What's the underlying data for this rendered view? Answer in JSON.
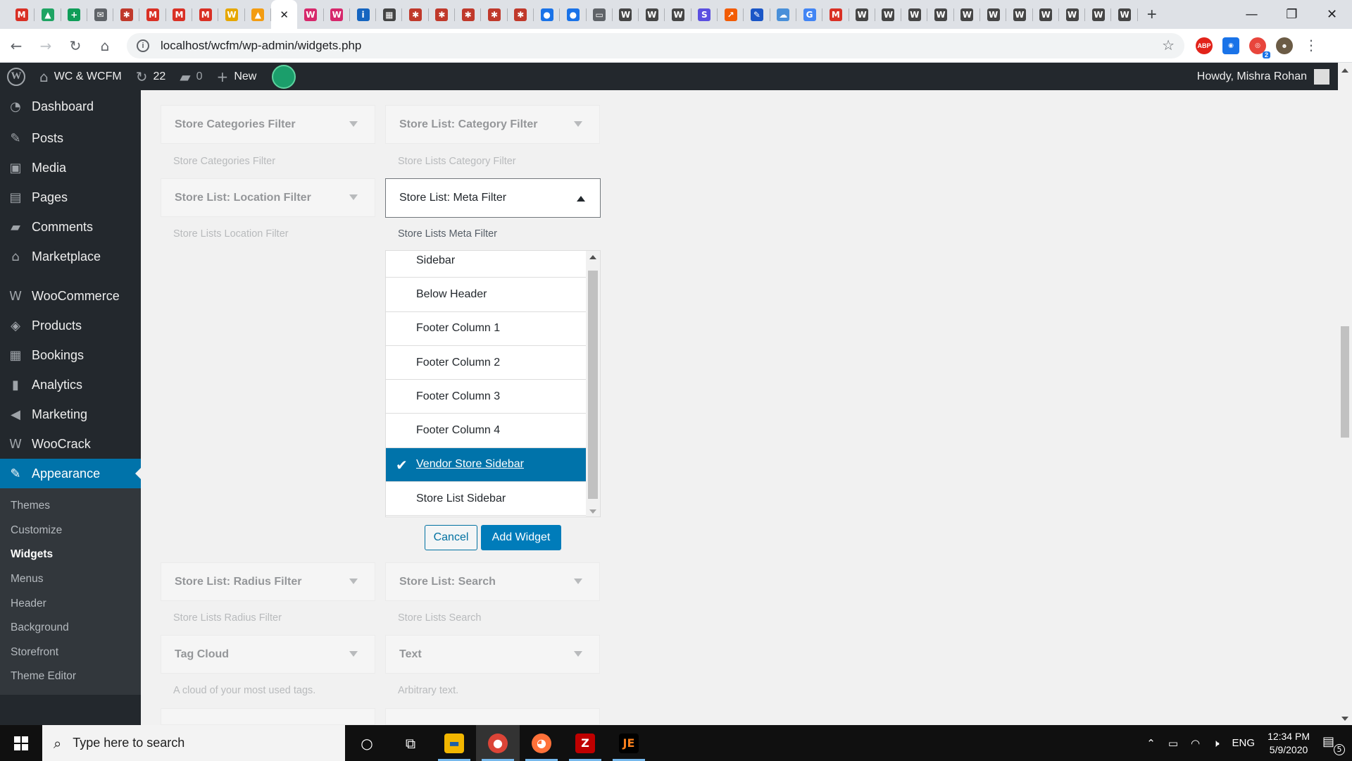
{
  "browser": {
    "tab_favicons": [
      {
        "icon": "gmail-icon",
        "glyph": "M",
        "color": "#d93025"
      },
      {
        "icon": "google-drive-icon",
        "glyph": "▲",
        "color": "#1fa463"
      },
      {
        "icon": "google-sheets-icon",
        "glyph": "+",
        "color": "#0f9d58"
      },
      {
        "icon": "mail-icon",
        "glyph": "✉",
        "color": "#5f6368"
      },
      {
        "icon": "site-icon",
        "glyph": "✱",
        "color": "#c0392b"
      },
      {
        "icon": "gmail-icon",
        "glyph": "M",
        "color": "#d93025"
      },
      {
        "icon": "gmail-icon",
        "glyph": "M",
        "color": "#d93025"
      },
      {
        "icon": "gmail-icon",
        "glyph": "M",
        "color": "#d93025"
      },
      {
        "icon": "site-icon",
        "glyph": "W",
        "color": "#e6a700"
      },
      {
        "icon": "phpmyadmin-icon",
        "glyph": "▲",
        "color": "#f39c12"
      },
      {
        "icon": "site-icon",
        "glyph": "✱",
        "color": "#c0392b"
      },
      {
        "icon": "woocommerce-icon",
        "glyph": "W",
        "color": "#d6286b"
      },
      {
        "icon": "woocommerce-icon",
        "glyph": "W",
        "color": "#d6286b"
      },
      {
        "icon": "ibb-icon",
        "glyph": "i",
        "color": "#1565c0"
      },
      {
        "icon": "film-icon",
        "glyph": "▦",
        "color": "#444"
      },
      {
        "icon": "site-icon",
        "glyph": "✱",
        "color": "#c0392b"
      },
      {
        "icon": "site-icon",
        "glyph": "✱",
        "color": "#c0392b"
      },
      {
        "icon": "site-icon",
        "glyph": "✱",
        "color": "#c0392b"
      },
      {
        "icon": "site-icon",
        "glyph": "✱",
        "color": "#c0392b"
      },
      {
        "icon": "site-icon",
        "glyph": "✱",
        "color": "#c0392b"
      },
      {
        "icon": "globe-icon",
        "glyph": "●",
        "color": "#1a73e8"
      },
      {
        "icon": "globe-icon",
        "glyph": "●",
        "color": "#1a73e8"
      },
      {
        "icon": "monitor-icon",
        "glyph": "▭",
        "color": "#5f6368"
      },
      {
        "icon": "wordpress-icon",
        "glyph": "W",
        "color": "#464646"
      },
      {
        "icon": "wordpress-icon",
        "glyph": "W",
        "color": "#464646"
      },
      {
        "icon": "wordpress-icon",
        "glyph": "W",
        "color": "#464646"
      },
      {
        "icon": "s-icon",
        "glyph": "S",
        "color": "#5b4fe0"
      },
      {
        "icon": "arrow-icon",
        "glyph": "↗",
        "color": "#f25c05"
      },
      {
        "icon": "feather-icon",
        "glyph": "✎",
        "color": "#1a56c7"
      },
      {
        "icon": "cloud-icon",
        "glyph": "☁",
        "color": "#4a90d9"
      },
      {
        "icon": "google-icon",
        "glyph": "G",
        "color": "#4285f4"
      },
      {
        "icon": "gmail-icon",
        "glyph": "M",
        "color": "#d93025"
      },
      {
        "icon": "wordpress-icon",
        "glyph": "W",
        "color": "#464646"
      },
      {
        "icon": "wordpress-icon",
        "glyph": "W",
        "color": "#464646"
      },
      {
        "icon": "wordpress-icon",
        "glyph": "W",
        "color": "#464646"
      },
      {
        "icon": "wordpress-icon",
        "glyph": "W",
        "color": "#464646"
      },
      {
        "icon": "wordpress-icon",
        "glyph": "W",
        "color": "#464646"
      },
      {
        "icon": "wordpress-icon",
        "glyph": "W",
        "color": "#464646"
      },
      {
        "icon": "wordpress-icon",
        "glyph": "W",
        "color": "#464646"
      },
      {
        "icon": "wordpress-icon",
        "glyph": "W",
        "color": "#464646"
      },
      {
        "icon": "wordpress-icon",
        "glyph": "W",
        "color": "#464646"
      },
      {
        "icon": "wordpress-icon",
        "glyph": "W",
        "color": "#464646"
      },
      {
        "icon": "wordpress-icon",
        "glyph": "W",
        "color": "#464646"
      }
    ],
    "active_tab_index": 10,
    "url": "localhost/wcfm/wp-admin/widgets.php",
    "extension_badge": "2"
  },
  "adminbar": {
    "site_name": "WC & WCFM",
    "updates_count": "22",
    "comments_count": "0",
    "new_label": "New",
    "greeting": "Howdy, Mishra Rohan"
  },
  "sidebar": {
    "items": [
      {
        "label": "Dashboard",
        "icon": "dashboard-icon",
        "glyph": "◔"
      },
      {
        "label": "Posts",
        "icon": "pin-icon",
        "glyph": "✎"
      },
      {
        "label": "Media",
        "icon": "media-icon",
        "glyph": "▣"
      },
      {
        "label": "Pages",
        "icon": "pages-icon",
        "glyph": "▤"
      },
      {
        "label": "Comments",
        "icon": "comment-icon",
        "glyph": "▰"
      },
      {
        "label": "Marketplace",
        "icon": "marketplace-icon",
        "glyph": "⌂"
      },
      {
        "label": "WooCommerce",
        "icon": "woocommerce-icon",
        "glyph": "W"
      },
      {
        "label": "Products",
        "icon": "box-icon",
        "glyph": "◈"
      },
      {
        "label": "Bookings",
        "icon": "calendar-icon",
        "glyph": "▦"
      },
      {
        "label": "Analytics",
        "icon": "bar-chart-icon",
        "glyph": "▮"
      },
      {
        "label": "Marketing",
        "icon": "megaphone-icon",
        "glyph": "◀"
      },
      {
        "label": "WooCrack",
        "icon": "woocrack-icon",
        "glyph": "W"
      },
      {
        "label": "Appearance",
        "icon": "brush-icon",
        "glyph": "✎"
      }
    ],
    "submenu": [
      "Themes",
      "Customize",
      "Widgets",
      "Menus",
      "Header",
      "Background",
      "Storefront",
      "Theme Editor"
    ]
  },
  "widgets": {
    "store_categories_filter": {
      "title": "Store Categories Filter",
      "desc": "Store Categories Filter"
    },
    "store_list_category_filter": {
      "title": "Store List: Category Filter",
      "desc": "Store Lists Category Filter"
    },
    "store_list_location_filter": {
      "title": "Store List: Location Filter",
      "desc": "Store Lists Location Filter"
    },
    "store_list_meta_filter": {
      "title": "Store List: Meta Filter",
      "desc": "Store Lists Meta Filter"
    },
    "store_list_radius_filter": {
      "title": "Store List: Radius Filter",
      "desc": "Store Lists Radius Filter"
    },
    "store_list_search": {
      "title": "Store List: Search",
      "desc": "Store Lists Search"
    },
    "tag_cloud": {
      "title": "Tag Cloud",
      "desc": "A cloud of your most used tags."
    },
    "text": {
      "title": "Text",
      "desc": "Arbitrary text."
    }
  },
  "chooser": {
    "options": [
      "Sidebar",
      "Below Header",
      "Footer Column 1",
      "Footer Column 2",
      "Footer Column 3",
      "Footer Column 4",
      "Vendor Store Sidebar",
      "Store List Sidebar"
    ],
    "selected_index": 6,
    "cancel_label": "Cancel",
    "add_label": "Add Widget"
  },
  "taskbar": {
    "search_placeholder": "Type here to search",
    "language": "ENG",
    "time": "12:34 PM",
    "date": "5/9/2020",
    "notification_count": "5"
  }
}
